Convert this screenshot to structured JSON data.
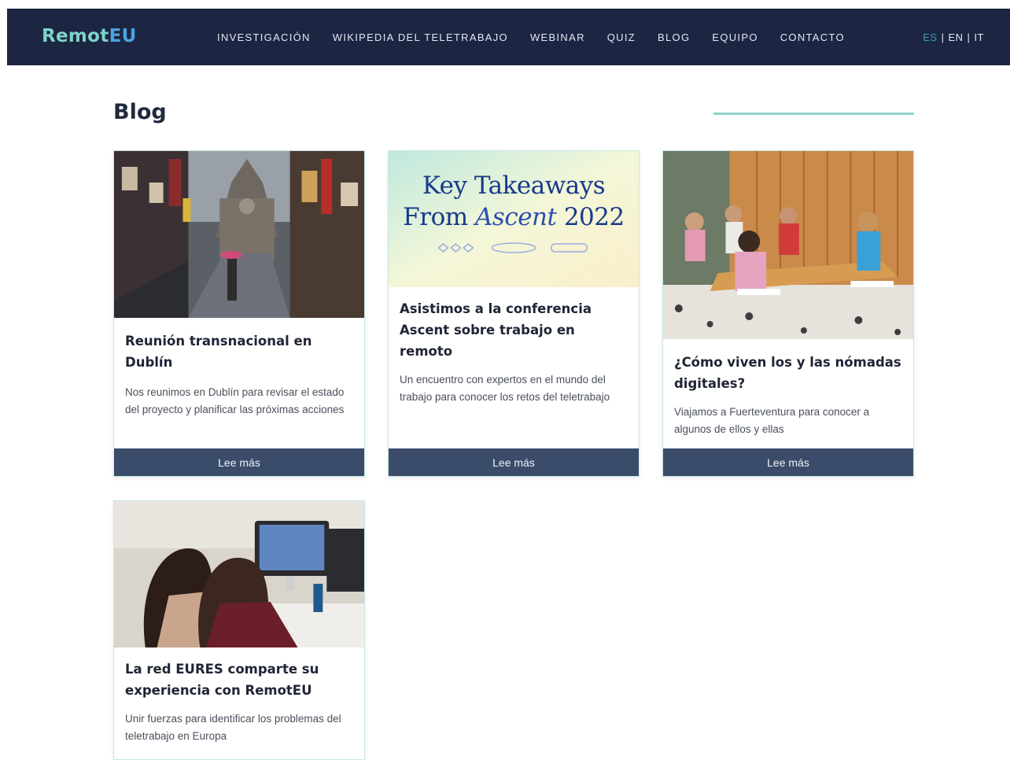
{
  "nav": {
    "logo": {
      "part1": "R",
      "part2": "emot",
      "part3": "EU"
    },
    "links": [
      {
        "label": "INVESTIGACIÓN"
      },
      {
        "label": "WIKIPEDIA DEL TELETRABAJO"
      },
      {
        "label": "WEBINAR"
      },
      {
        "label": "QUIZ"
      },
      {
        "label": "BLOG"
      },
      {
        "label": "EQUIPO"
      },
      {
        "label": "CONTACTO"
      }
    ],
    "languages": {
      "active": "ES",
      "en": "EN",
      "it": "IT",
      "separator": "|"
    }
  },
  "page": {
    "title": "Blog"
  },
  "colors": {
    "nav_bg": "#1c2542",
    "accent_teal": "#8fd4cc",
    "button_bg": "#3a4c6a"
  },
  "cards": [
    {
      "title": "Reunión transnacional en Dublín",
      "excerpt": "Nos reunimos en Dublín para revisar el estado del proyecto y planificar las próximas acciones",
      "button": "Lee más"
    },
    {
      "title": "Asistimos a la conferencia Ascent sobre trabajo en remoto",
      "excerpt": "Un encuentro con expertos en el mundo del trabajo para conocer los retos del teletrabajo",
      "button": "Lee más",
      "image_text": {
        "line1": "Key Takeaways",
        "line2_a": "From ",
        "line2_b": "Ascent",
        "line2_c": " 2022"
      }
    },
    {
      "title": "¿Cómo viven los y las nómadas digitales?",
      "excerpt": "Viajamos a Fuerteventura para conocer a algunos de ellos y ellas",
      "button": "Lee más"
    },
    {
      "title": "La red EURES comparte su experiencia con RemotEU",
      "excerpt": "Unir fuerzas para identificar los problemas del teletrabajo en Europa"
    }
  ]
}
